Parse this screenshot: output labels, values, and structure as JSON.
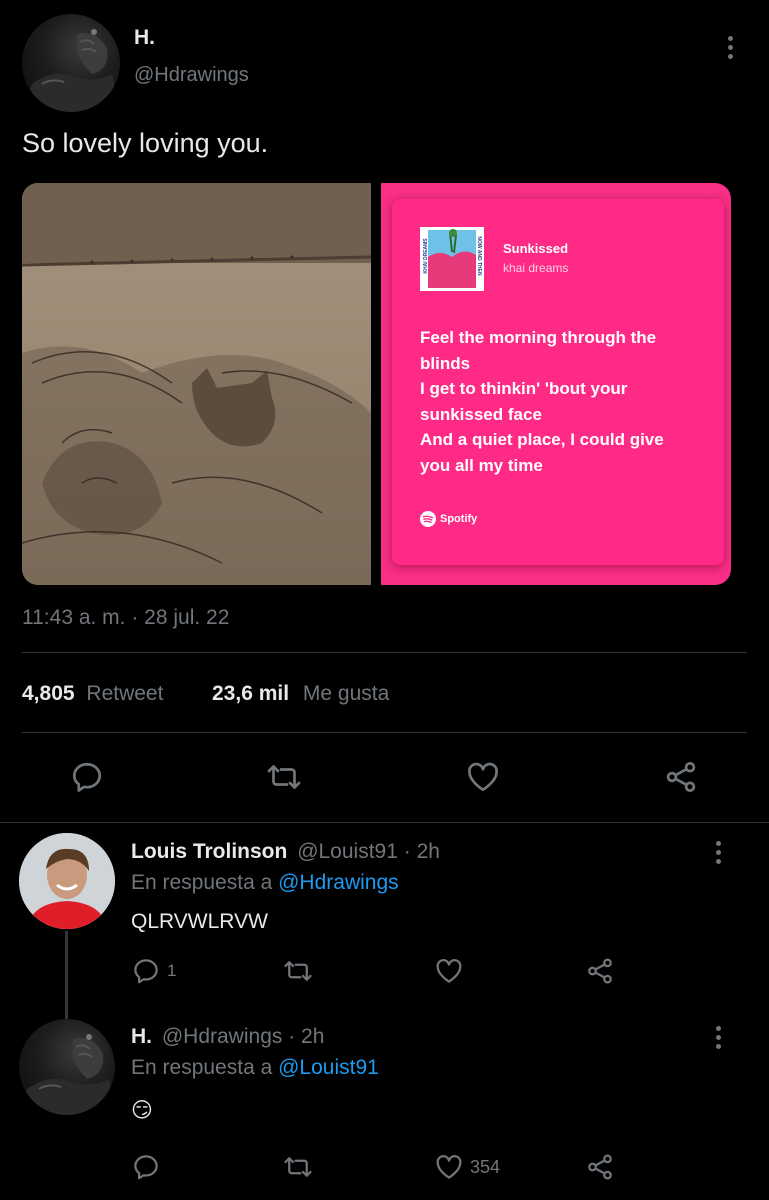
{
  "tweet": {
    "author_name": "H.",
    "handle": "@Hdrawings",
    "text": "So lovely loving you.",
    "timestamp": "11:43 a. m. · 28 jul. 22",
    "stats": {
      "retweets": "4,805",
      "retweets_label": "Retweet",
      "likes": "23,6 mil",
      "likes_label": "Me gusta"
    },
    "spotify_card": {
      "song": "Sunkissed",
      "artist": "khai dreams",
      "lyrics": [
        "Feel the morning through the",
        "blinds",
        "I get to thinkin' 'bout your",
        "sunkissed face",
        "And a quiet place, I could give",
        "you all my time"
      ],
      "brand": "Spotify",
      "cover_text_left": "KHAI DREAMS",
      "cover_text_right": "NOW AND THEN",
      "bg_color": "#fa2f86"
    }
  },
  "replies": [
    {
      "name": "Louis Trolinson",
      "handle": "@Louist91",
      "time": "· 2h",
      "reply_prefix": "En respuesta a",
      "reply_to": "@Hdrawings",
      "text": "QLRVWLRVW",
      "reply_count": "1",
      "like_count": ""
    },
    {
      "name": "H.",
      "handle": "@Hdrawings",
      "time": "· 2h",
      "reply_prefix": "En respuesta a",
      "reply_to": "@Louist91",
      "text": "😏",
      "reply_count": "",
      "like_count": "354"
    }
  ],
  "colors": {
    "background": "#000000",
    "text": "#e7e9ea",
    "muted": "#71767b",
    "link": "#1d9bf0",
    "divider": "#2f3336"
  }
}
